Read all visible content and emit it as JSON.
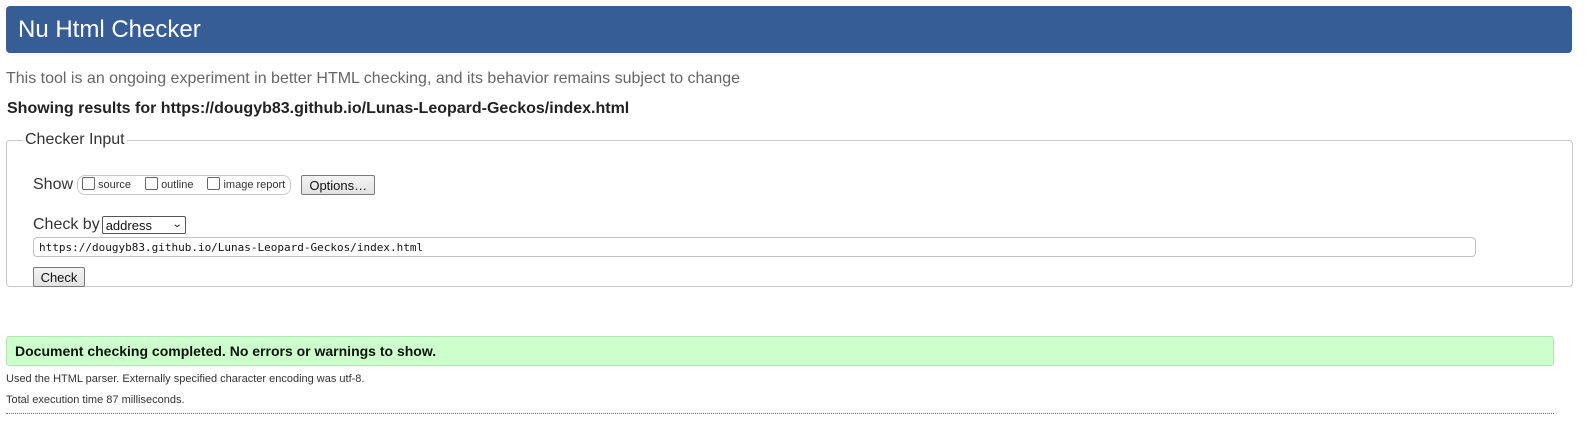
{
  "header": {
    "title": "Nu Html Checker"
  },
  "tagline": "This tool is an ongoing experiment in better HTML checking, and its behavior remains subject to change",
  "results_for": "Showing results for https://dougyb83.github.io/Lunas-Leopard-Geckos/index.html",
  "checker_input": {
    "legend": "Checker Input",
    "show_label": "Show",
    "show_options": [
      {
        "label": "source",
        "checked": false
      },
      {
        "label": "outline",
        "checked": false
      },
      {
        "label": "image report",
        "checked": false
      }
    ],
    "options_button": "Options…",
    "check_by_label": "Check by",
    "check_by_selected": "address",
    "url_value": "https://dougyb83.github.io/Lunas-Leopard-Geckos/index.html",
    "check_button": "Check"
  },
  "result": {
    "success_message": "Document checking completed. No errors or warnings to show.",
    "parser_info": "Used the HTML parser. Externally specified character encoding was utf-8.",
    "execution_time": "Total execution time 87 milliseconds."
  },
  "colors": {
    "header_bg": "#365d95",
    "success_bg": "#ccffcc"
  },
  "icons": {
    "select_chevron": "chevron-down-icon"
  }
}
